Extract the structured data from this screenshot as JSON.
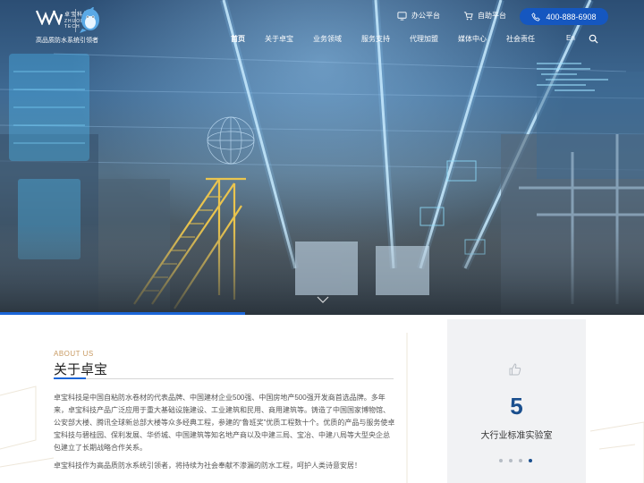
{
  "header": {
    "logo_cn": "卓宝科技",
    "logo_en": "ZHUOBAO TECH",
    "slogan": "高品质防水系统引领者",
    "office_label": "办公平台",
    "platform_label": "自助平台",
    "phone": "400-888-6908",
    "search_icon": "search-icon"
  },
  "nav": {
    "items": [
      "首页",
      "关于卓宝",
      "业务领域",
      "服务支持",
      "代理加盟",
      "媒体中心",
      "社会责任"
    ],
    "lang": "En",
    "active_index": 0
  },
  "hero": {
    "slide_progress": 0.38
  },
  "about": {
    "subtitle": "ABOUT US",
    "title": "关于卓宝",
    "paragraph1": "卓宝科技是中国自粘防水卷材的代表品牌、中国建材企业500强、中国房地产500强开发商首选品牌。多年来，卓宝科技产品广泛应用于重大基础设施建设、工业建筑和民用、商用建筑等。铸造了中国国家博物馆、公安部大楼、腾讯全球新总部大楼等众多经典工程，参建的“鲁班奖”优质工程数十个。优质的产品与服务使卓宝科技与碧桂园、保利发展、华侨城、中国建筑等知名地产商以及中建三局、宝冶、中建八局等大型央企总包建立了长期战略合作关系。",
    "paragraph2": "卓宝科技作为高品质防水系统引领者，将持续为社会奉献不渗漏的防水工程，呵护人类诗意安居！"
  },
  "stat": {
    "icon": "thumbs-up-icon",
    "value": "5",
    "label": "大行业标准实验室",
    "dots_total": 4,
    "active_dot": 3
  },
  "colors": {
    "accent": "#1557c0",
    "brand_dark": "#1a4f8e",
    "gold": "#c89a62"
  }
}
